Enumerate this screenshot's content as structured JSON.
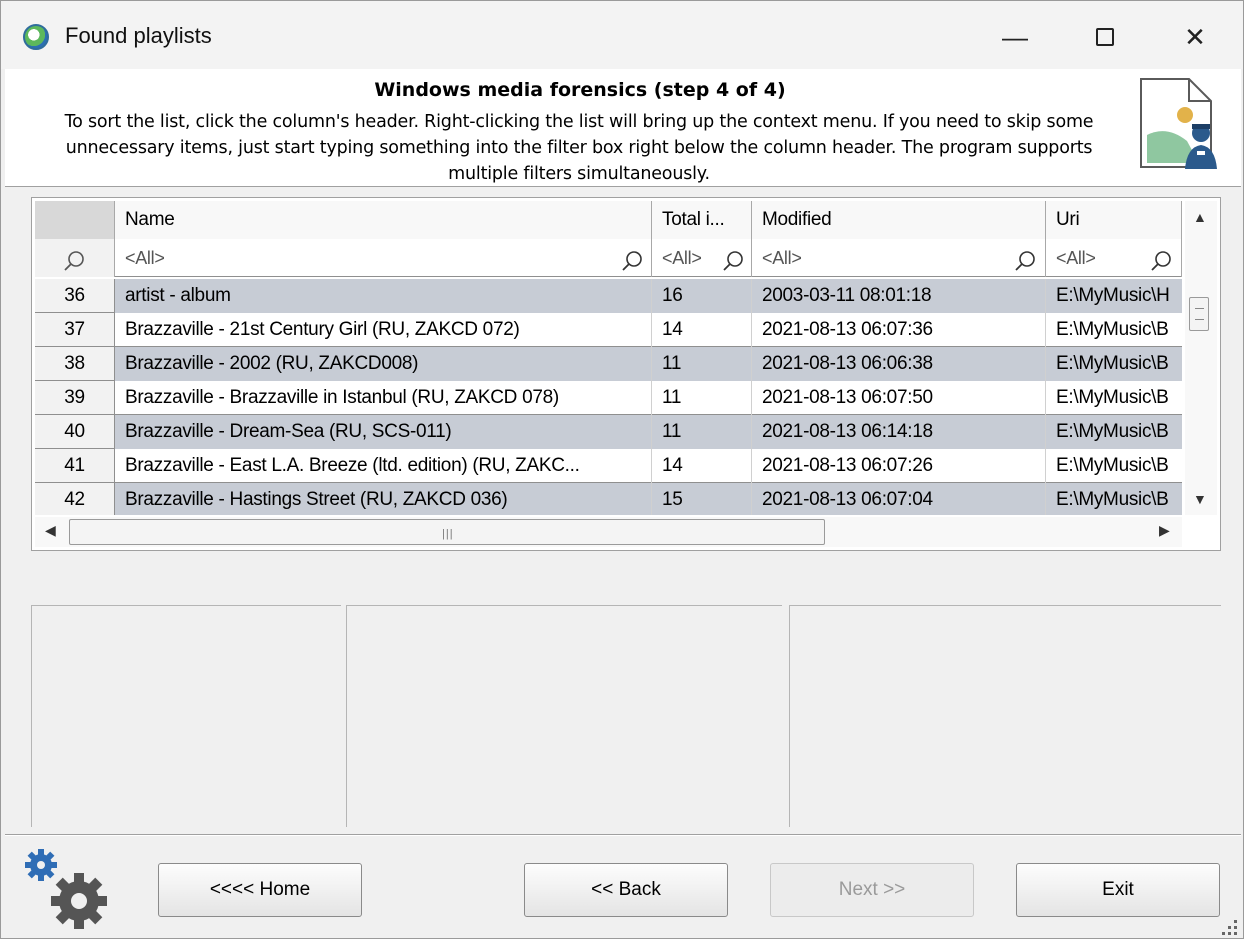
{
  "window": {
    "title": "Found playlists",
    "minimize_glyph": "—",
    "close_glyph": "✕"
  },
  "header": {
    "title": "Windows media forensics (step 4 of 4)",
    "description": "To sort the list, click the column's header. Right-clicking the list will bring up the context menu. If you need to skip some unnecessary items, just start typing something into the filter box right below the column header. The program supports multiple filters simultaneously.",
    "icon": "document-with-inspector-icon"
  },
  "grid": {
    "columns": [
      "",
      "Name",
      "Total i...",
      "Modified",
      "Uri"
    ],
    "filter_placeholder": "<All>",
    "rows": [
      {
        "idx": "36",
        "name": "artist - album",
        "total": "16",
        "modified": "2003-03-11 08:01:18",
        "uri": "E:\\MyMusic\\H"
      },
      {
        "idx": "37",
        "name": "Brazzaville - 21st Century Girl (RU, ZAKCD 072)",
        "total": "14",
        "modified": "2021-08-13 06:07:36",
        "uri": "E:\\MyMusic\\B"
      },
      {
        "idx": "38",
        "name": "Brazzaville - 2002 (RU, ZAKCD008)",
        "total": "11",
        "modified": "2021-08-13 06:06:38",
        "uri": "E:\\MyMusic\\B"
      },
      {
        "idx": "39",
        "name": "Brazzaville - Brazzaville in Istanbul (RU, ZAKCD 078)",
        "total": "11",
        "modified": "2021-08-13 06:07:50",
        "uri": "E:\\MyMusic\\B"
      },
      {
        "idx": "40",
        "name": "Brazzaville - Dream-Sea (RU, SCS-011)",
        "total": "11",
        "modified": "2021-08-13 06:14:18",
        "uri": "E:\\MyMusic\\B"
      },
      {
        "idx": "41",
        "name": "Brazzaville - East L.A. Breeze (ltd. edition) (RU, ZAKC...",
        "total": "14",
        "modified": "2021-08-13 06:07:26",
        "uri": "E:\\MyMusic\\B"
      },
      {
        "idx": "42",
        "name": "Brazzaville - Hastings Street (RU, ZAKCD 036)",
        "total": "15",
        "modified": "2021-08-13 06:07:04",
        "uri": "E:\\MyMusic\\B"
      }
    ],
    "hscroll_grip": "|||"
  },
  "buttons": {
    "home": "<<<< Home",
    "back": "<< Back",
    "next": "Next >>",
    "exit": "Exit"
  }
}
